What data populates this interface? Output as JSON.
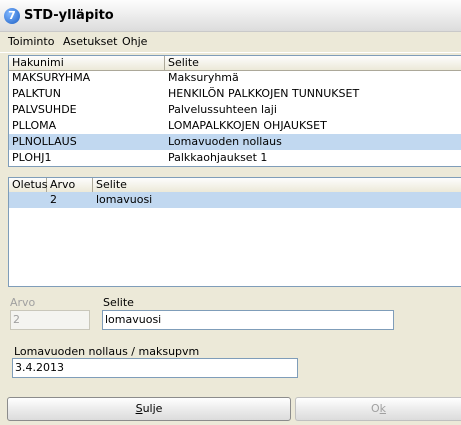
{
  "window": {
    "title": "STD-ylläpito",
    "icon": "app-icon-letter-7"
  },
  "menu": [
    "Toiminto",
    "Asetukset",
    "Ohje"
  ],
  "list1": {
    "columns": [
      "Hakunimi",
      "Selite"
    ],
    "rows": [
      [
        "MAKSURYHMA",
        "Maksuryhmä"
      ],
      [
        "PALKTUN",
        "HENKILÖN PALKKOJEN TUNNUKSET"
      ],
      [
        "PALVSUHDE",
        "Palvelussuhteen laji"
      ],
      [
        "PLLOMA",
        "LOMAPALKKOJEN OHJAUKSET"
      ],
      [
        "PLNOLLAUS",
        "Lomavuoden nollaus"
      ],
      [
        "PLOHJ1",
        "Palkkaohjaukset 1"
      ]
    ],
    "selected_index": 4
  },
  "list2": {
    "columns": [
      "Oletus",
      "Arvo",
      "Selite"
    ],
    "rows": [
      [
        "",
        "2",
        "lomavuosi"
      ]
    ],
    "selected_index": 0
  },
  "form": {
    "arvo_label": "Arvo",
    "arvo_value": "2",
    "selite_label": "Selite",
    "selite_value": "lomavuosi",
    "date_label": "Lomavuoden nollaus / maksupvm",
    "date_value": "3.4.2013"
  },
  "buttons": {
    "close": {
      "prefix": "",
      "underlined": "S",
      "rest": "ulje"
    },
    "ok": {
      "prefix": "O",
      "underlined": "k",
      "rest": ""
    }
  },
  "colors": {
    "selection": "#c1d8f0",
    "background": "#ece9d8"
  }
}
